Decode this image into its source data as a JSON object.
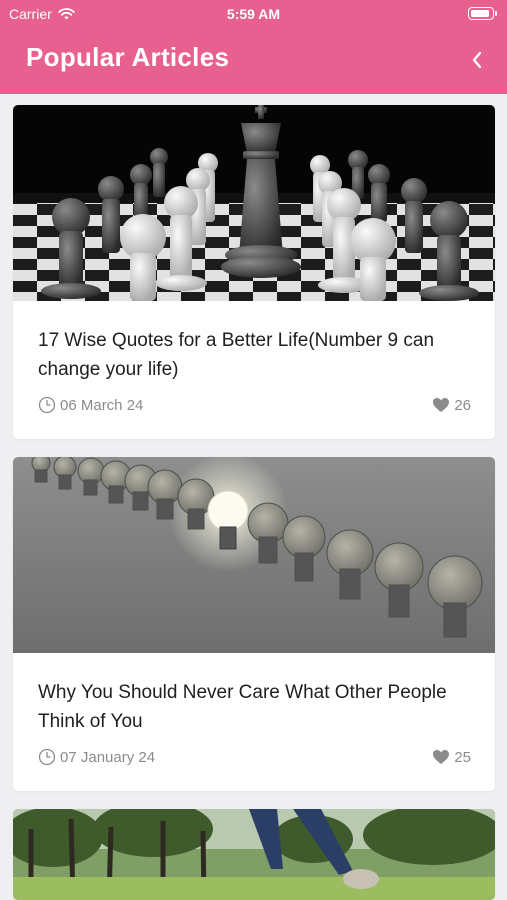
{
  "status_bar": {
    "carrier": "Carrier",
    "time": "5:59 AM",
    "battery_level": 0.85
  },
  "header": {
    "title": "Popular Articles",
    "back_icon": "chevron-left-icon",
    "color": "#e8608f"
  },
  "articles": [
    {
      "title": "17 Wise Quotes for a Better Life(Number 9 can change your life)",
      "date": "06 March 24",
      "likes": "26",
      "image": "chess-pieces-photo"
    },
    {
      "title": "Why You Should Never Care What Other People Think of You",
      "date": "07 January 24",
      "likes": "25",
      "image": "light-bulbs-photo"
    },
    {
      "title": "",
      "date": "",
      "likes": "",
      "image": "park-runner-photo"
    }
  ]
}
